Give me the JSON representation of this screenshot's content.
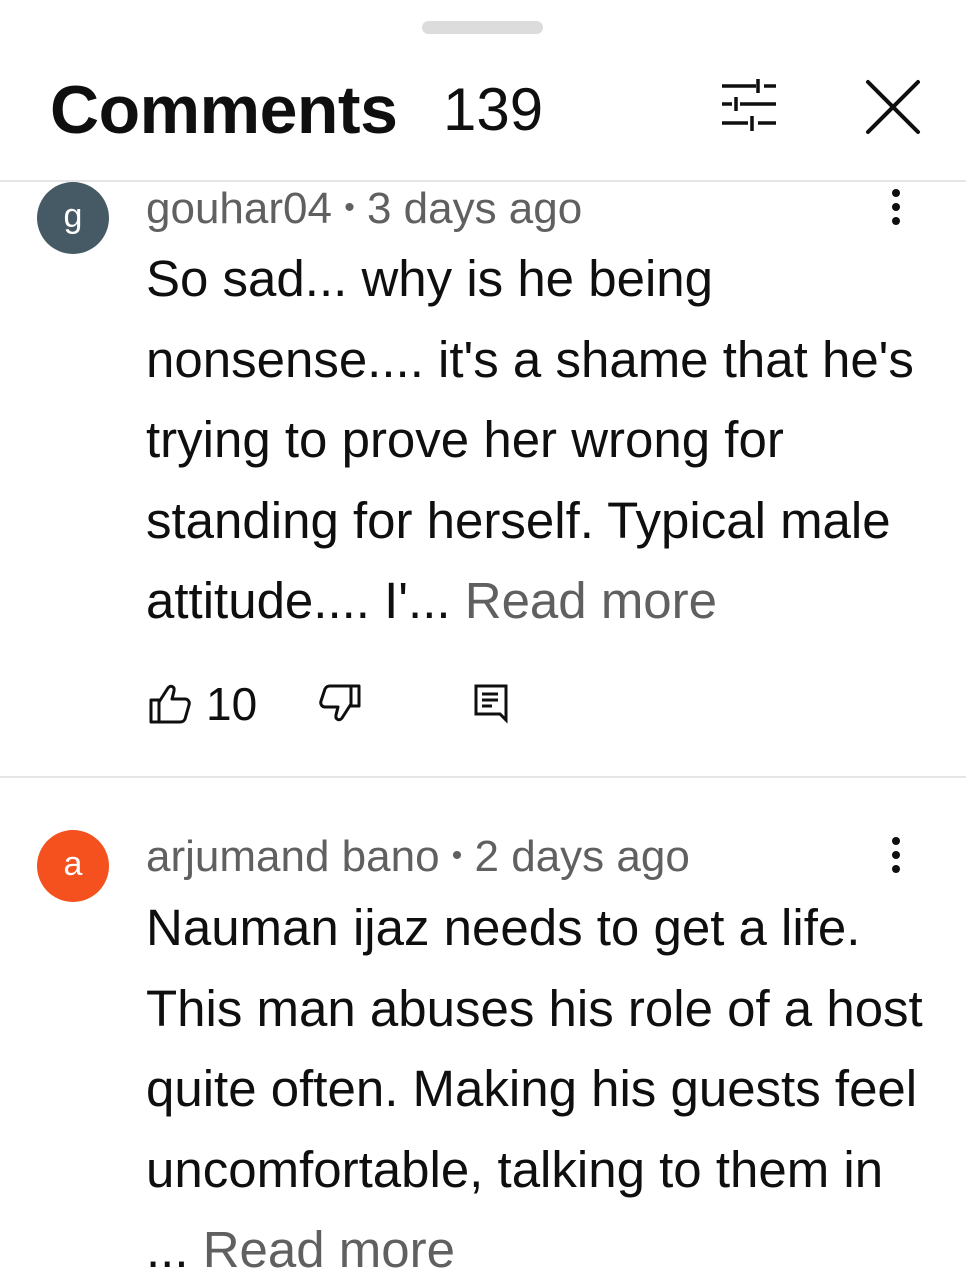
{
  "header": {
    "title": "Comments",
    "count": "139",
    "filter_icon": "tune-icon",
    "close_icon": "close-icon"
  },
  "colors": {
    "text": "#0f0f0f",
    "secondary_text": "#606060",
    "divider": "#e5e5e5"
  },
  "comments": [
    {
      "author": "gouhar04",
      "separator": "•",
      "time": "3 days ago",
      "avatar_letter": "g",
      "avatar_color": "#455a64",
      "text": "So sad... why is he being nonsense.... it's a shame that he's trying to prove her wrong for standing for herself. Typical male attitude.... I'... ",
      "read_more": "Read more",
      "likes": "10"
    },
    {
      "author": "arjumand bano",
      "separator": "•",
      "time": "2 days ago",
      "avatar_letter": "a",
      "avatar_color": "#f4511e",
      "text": "Nauman ijaz needs to get a life. This man abuses his role of a host quite often. Making his guests feel uncomfortable, talking to them in ... ",
      "read_more": "Read more"
    }
  ]
}
